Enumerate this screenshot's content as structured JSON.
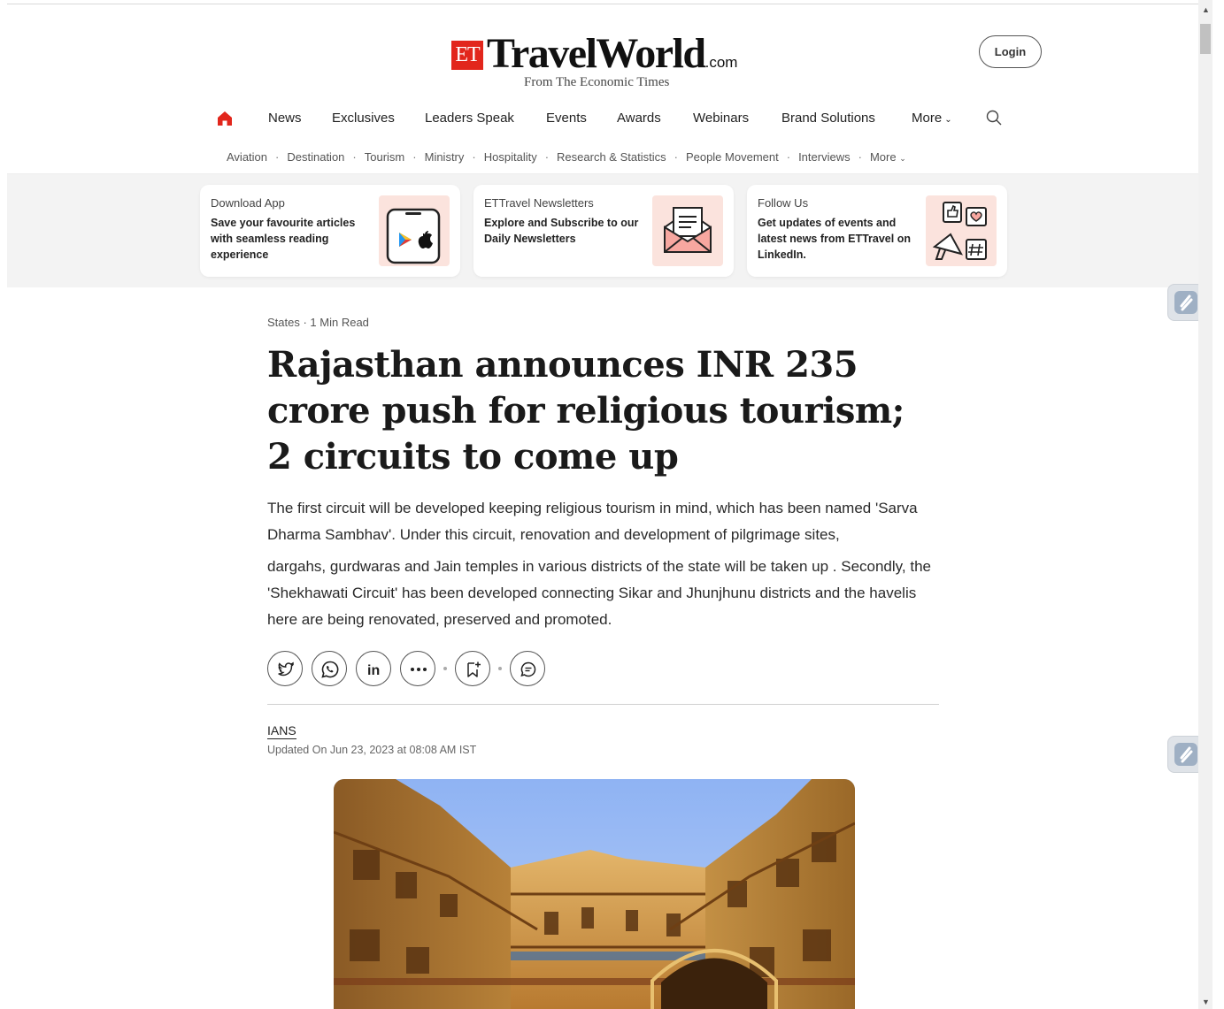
{
  "brand": {
    "et": "ET",
    "name_a": "Travel",
    "name_b": "World",
    "com": ".com",
    "tagline": "From The Economic Times",
    "accent": "#e2261c"
  },
  "header": {
    "login_label": "Login"
  },
  "nav_primary": {
    "items": [
      "News",
      "Exclusives",
      "Leaders Speak",
      "Events",
      "Awards",
      "Webinars",
      "Brand Solutions"
    ],
    "more_label": "More"
  },
  "nav_secondary": {
    "items": [
      "Aviation",
      "Destination",
      "Tourism",
      "Ministry",
      "Hospitality",
      "Research & Statistics",
      "People Movement",
      "Interviews"
    ],
    "more_label": "More"
  },
  "promo_cards": [
    {
      "title": "Download App",
      "text": "Save your favourite articles with seamless reading experience",
      "icon": "phone-app-icon"
    },
    {
      "title": "ETTravel Newsletters",
      "text": "Explore and Subscribe to our Daily Newsletters",
      "icon": "newsletter-icon"
    },
    {
      "title": "Follow Us",
      "text": "Get updates of events and latest news from ETTravel on LinkedIn.",
      "icon": "social-icon"
    }
  ],
  "article": {
    "section": "States",
    "read_time": "1 Min Read",
    "headline": "Rajasthan announces INR 235 crore push for religious tourism; 2 circuits to come up",
    "summary_1": "The first circuit will be developed keeping religious tourism in mind, which has been named 'Sarva Dharma Sambhav'. Under this circuit, renovation and development of pilgrimage sites,",
    "summary_2": "dargahs, gurdwaras and Jain temples in various districts of the state will be taken up . Secondly, the 'Shekhawati Circuit' has been developed connecting Sikar and Jhunjhunu districts and the havelis here are being renovated, preserved and promoted.",
    "author": "IANS",
    "updated": "Updated On Jun 23, 2023 at 08:08 AM IST"
  }
}
